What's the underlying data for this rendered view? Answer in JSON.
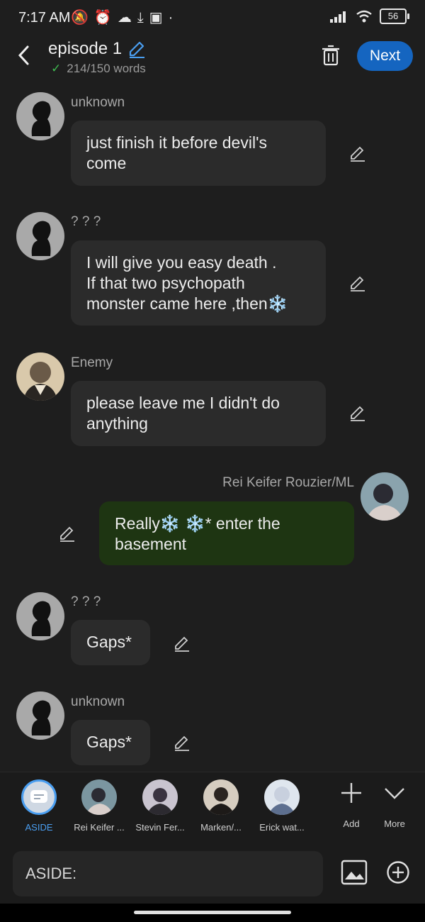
{
  "status": {
    "time": "7:17 AM",
    "battery": "56"
  },
  "header": {
    "title": "episode 1",
    "word_count": "214/150 words",
    "next_label": "Next"
  },
  "messages": [
    {
      "sender": "unknown",
      "text_lines": [
        "just finish it before devil's",
        "come"
      ]
    },
    {
      "sender": "? ? ?",
      "text_lines": [
        "I will give you easy death .",
        "If that two psychopath",
        "monster came here ,then❄️"
      ]
    },
    {
      "sender": "Enemy",
      "text_lines": [
        "please leave me I didn't do",
        "anything"
      ]
    },
    {
      "sender": "Rei Keifer Rouzier/ML",
      "text_lines": [
        "Really❄️ ❄️* enter the",
        "basement"
      ]
    },
    {
      "sender": "? ? ?",
      "text_lines": [
        "Gaps*"
      ]
    },
    {
      "sender": "unknown",
      "text_lines": [
        "Gaps*"
      ]
    }
  ],
  "characters": [
    {
      "label": "ASIDE"
    },
    {
      "label": "Rei Keifer ..."
    },
    {
      "label": "Stevin Fer..."
    },
    {
      "label": "Marken/..."
    },
    {
      "label": "Erick wat..."
    }
  ],
  "actions": {
    "add_label": "Add",
    "more_label": "More"
  },
  "input": {
    "value": "ASIDE:"
  },
  "colors": {
    "accent": "#1565c0",
    "own_bubble": "#1e3512",
    "bubble": "#2b2b2b",
    "aside_accent": "#4a9ef0"
  }
}
